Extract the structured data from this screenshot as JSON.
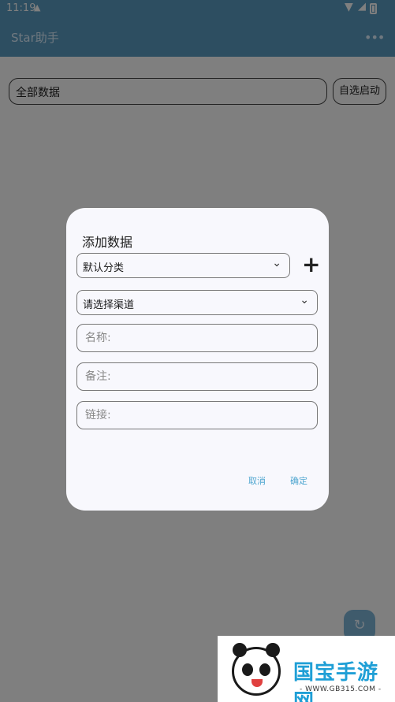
{
  "statusbar": {
    "time": "11:19",
    "notification_icon": "cat-icon",
    "wifi_icon": "wifi-icon",
    "battery_icon": "battery-icon"
  },
  "appbar": {
    "title": "Star助手",
    "menu_icon": "more-dots-icon"
  },
  "toolbar": {
    "filter_value": "全部数据",
    "autostart_label": "自选启动"
  },
  "fab": {
    "icon": "refresh-icon"
  },
  "dialog": {
    "title": "添加数据",
    "category_value": "默认分类",
    "add_category_icon": "plus-icon",
    "channel_value": "请选择渠道",
    "name_placeholder": "名称:",
    "note_placeholder": "备注:",
    "link_placeholder": "链接:",
    "cancel_label": "取消",
    "ok_label": "确定"
  },
  "watermark": {
    "title": "国宝手游网",
    "url": "- WWW.GB315.COM -"
  },
  "colors": {
    "appbar": "#5a9cc2",
    "accent": "#4fa6d0",
    "dialog_bg": "#f8f8fd"
  }
}
